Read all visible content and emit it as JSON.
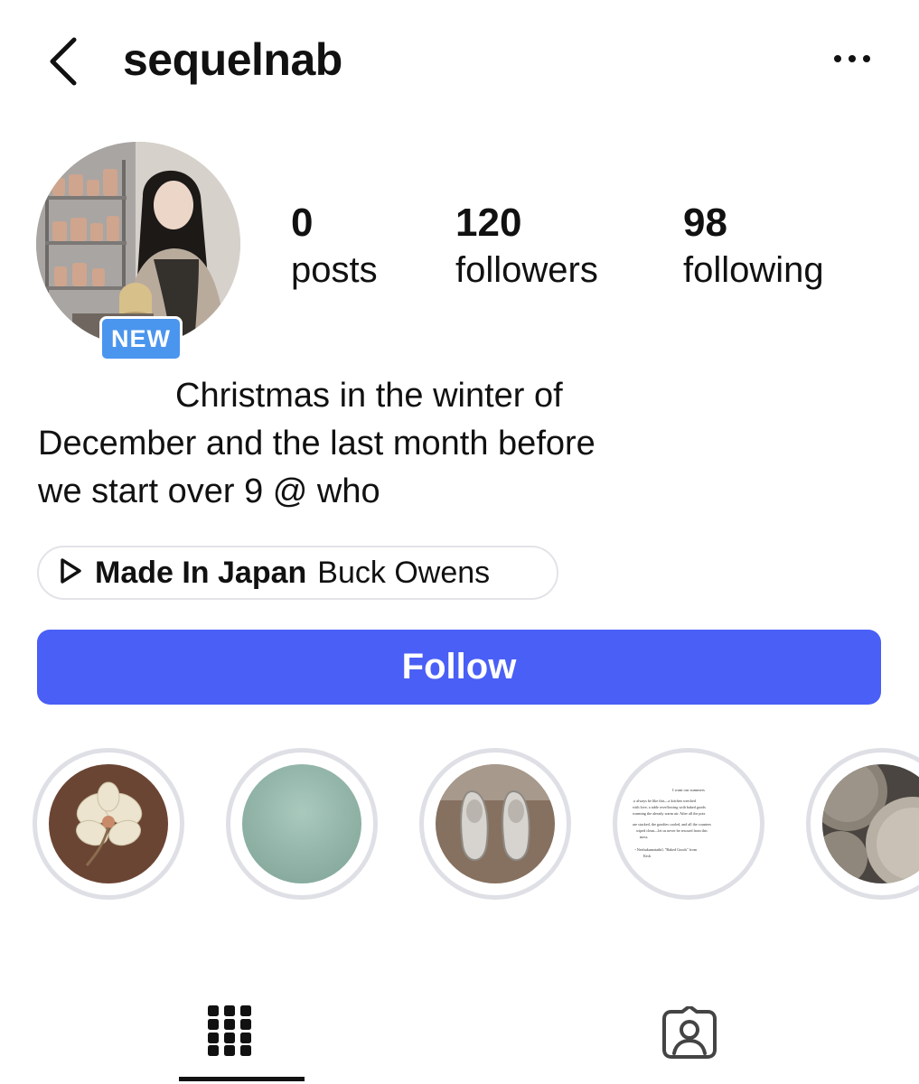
{
  "header": {
    "username": "sequelnab"
  },
  "profile": {
    "badge": "NEW",
    "stats": [
      {
        "value": "0",
        "label": "posts"
      },
      {
        "value": "120",
        "label": "followers"
      },
      {
        "value": "98",
        "label": "following"
      }
    ]
  },
  "bio": {
    "lines": [
      "Christmas in the winter of",
      "December and the last month before",
      "we start over 9 @ who"
    ]
  },
  "music": {
    "title": "Made In Japan",
    "artist": "Buck Owens"
  },
  "actions": {
    "follow_label": "Follow"
  },
  "highlights": {
    "book_page_text": [
      "I want our summers",
      "to always be like this—a kitchen wrecked",
      "with love, a table overflowing with baked goods",
      "warming the already warm air. After all the pots",
      "are stacked, the goodies cooled, and all the counters",
      "wiped clean—let us never be rescued from this",
      "mess.",
      "ee Nezhukumatathil, \"Baked Goods\" from",
      "Kish"
    ]
  },
  "colors": {
    "follow": "#4a5ff5",
    "badge": "#4a95ee",
    "ring": "#dfe0e6"
  }
}
